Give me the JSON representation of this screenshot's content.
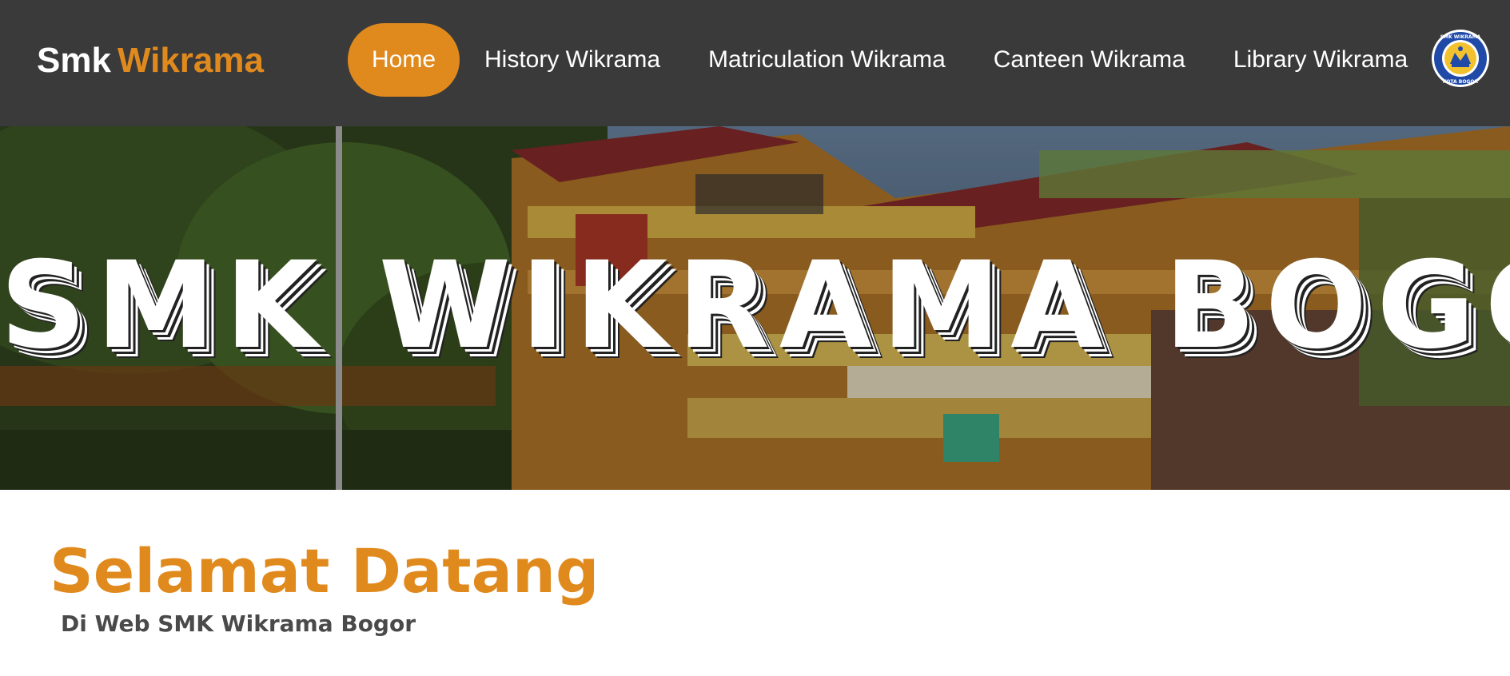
{
  "header": {
    "brand": {
      "part1": "Smk",
      "part2": "Wikrama"
    },
    "nav": [
      {
        "label": "Home",
        "active": true
      },
      {
        "label": "History Wikrama",
        "active": false
      },
      {
        "label": "Matriculation Wikrama",
        "active": false
      },
      {
        "label": "Canteen Wikrama",
        "active": false
      },
      {
        "label": "Library Wikrama",
        "active": false
      }
    ],
    "logo": {
      "icon": "school-crest-icon",
      "text_top": "SMK WIKRAMA",
      "text_bottom": "KOTA BOGOR"
    }
  },
  "hero": {
    "title": "SMK WIKRAMA BOGOR",
    "image": "school-building-photo"
  },
  "welcome": {
    "title": "Selamat Datang",
    "subtitle": "Di Web SMK Wikrama Bogor"
  },
  "colors": {
    "header_bg": "#3a3a3a",
    "accent": "#e08a1e",
    "text_light": "#ffffff",
    "text_dark": "#4a4a4a"
  }
}
